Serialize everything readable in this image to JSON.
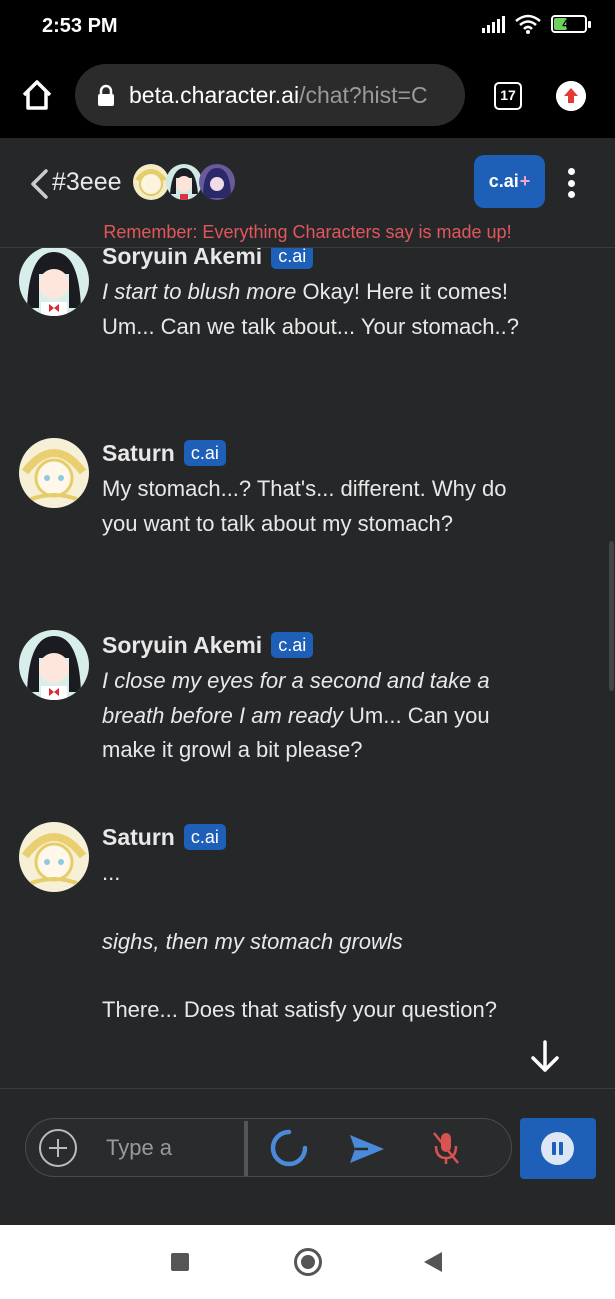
{
  "status_bar": {
    "time": "2:53 PM",
    "battery": "42"
  },
  "browser": {
    "url_host": "beta.character.ai",
    "url_path": "/chat?hist=C",
    "tab_count": "17"
  },
  "chat_header": {
    "title": "#3eee",
    "plan_label": "c.ai",
    "plan_plus": "+",
    "disclaimer": "Remember: Everything Characters say is made up!"
  },
  "messages": [
    {
      "name": "Soryuin Akemi",
      "badge": "c.ai",
      "italic": "I start to blush more",
      "text": " Okay! Here it comes! Um... Can we talk about... Your stomach..?"
    },
    {
      "name": "Saturn",
      "badge": "c.ai",
      "text": "My stomach...? That's... different. Why do you want to talk about my stomach?"
    },
    {
      "name": "Soryuin Akemi",
      "badge": "c.ai",
      "italic": "I close my eyes for a second and take a breath before I am ready",
      "text": " Um... Can you make it growl a bit please?"
    },
    {
      "name": "Saturn",
      "badge": "c.ai",
      "line1": "...",
      "italic": "sighs, then my stomach growls",
      "line3": "There... Does that satisfy your question?"
    }
  ],
  "composer": {
    "placeholder": "Type a"
  },
  "colors": {
    "accent": "#1e5fb8",
    "background": "#262729",
    "disclaimer": "#e2575c",
    "mic_muted": "#d9534f"
  }
}
